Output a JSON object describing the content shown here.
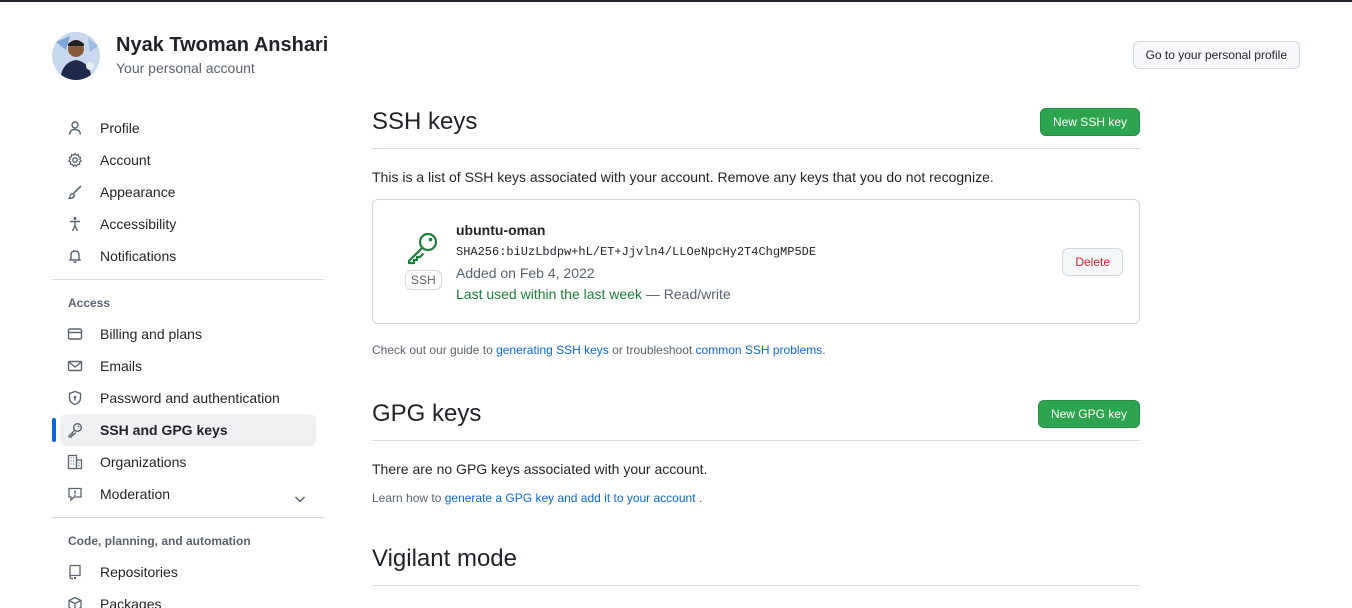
{
  "user": {
    "name": "Nyak Twoman Anshari",
    "subtitle": "Your personal account",
    "profile_button": "Go to your personal profile"
  },
  "sidebar": {
    "items_top": [
      {
        "label": "Profile",
        "icon": "person-icon"
      },
      {
        "label": "Account",
        "icon": "gear-icon"
      },
      {
        "label": "Appearance",
        "icon": "paintbrush-icon"
      },
      {
        "label": "Accessibility",
        "icon": "accessibility-icon"
      },
      {
        "label": "Notifications",
        "icon": "bell-icon"
      }
    ],
    "access_title": "Access",
    "items_access": [
      {
        "label": "Billing and plans",
        "icon": "credit-card-icon"
      },
      {
        "label": "Emails",
        "icon": "mail-icon"
      },
      {
        "label": "Password and authentication",
        "icon": "shield-lock-icon"
      },
      {
        "label": "SSH and GPG keys",
        "icon": "key-icon",
        "active": true
      },
      {
        "label": "Organizations",
        "icon": "organization-icon"
      },
      {
        "label": "Moderation",
        "icon": "report-icon"
      }
    ],
    "code_title": "Code, planning, and automation",
    "items_code": [
      {
        "label": "Repositories",
        "icon": "repo-icon"
      },
      {
        "label": "Packages",
        "icon": "package-icon"
      }
    ]
  },
  "ssh": {
    "title": "SSH keys",
    "new_button": "New SSH key",
    "description": "This is a list of SSH keys associated with your account. Remove any keys that you do not recognize.",
    "key": {
      "type_label": "SSH",
      "name": "ubuntu-oman",
      "fingerprint": "SHA256:biUzLbdpw+hL/ET+Jjvln4/LLOeNpcHy2T4ChgMP5DE",
      "added": "Added on Feb 4, 2022",
      "last_used": "Last used within the last week",
      "access": " — Read/write",
      "delete_button": "Delete"
    },
    "note_prefix": "Check out our guide to ",
    "note_link1": "generating SSH keys",
    "note_middle": " or troubleshoot ",
    "note_link2": "common SSH problems",
    "note_suffix": "."
  },
  "gpg": {
    "title": "GPG keys",
    "new_button": "New GPG key",
    "empty": "There are no GPG keys associated with your account.",
    "note_prefix": "Learn how to ",
    "note_link": "generate a GPG key and add it to your account",
    "note_suffix": " ."
  },
  "vigilant": {
    "title": "Vigilant mode"
  },
  "colors": {
    "primary_button": "#2da44e",
    "link": "#0969da",
    "active_indicator": "#0969da",
    "danger": "#cf222e",
    "success_text": "#1a7f37"
  }
}
